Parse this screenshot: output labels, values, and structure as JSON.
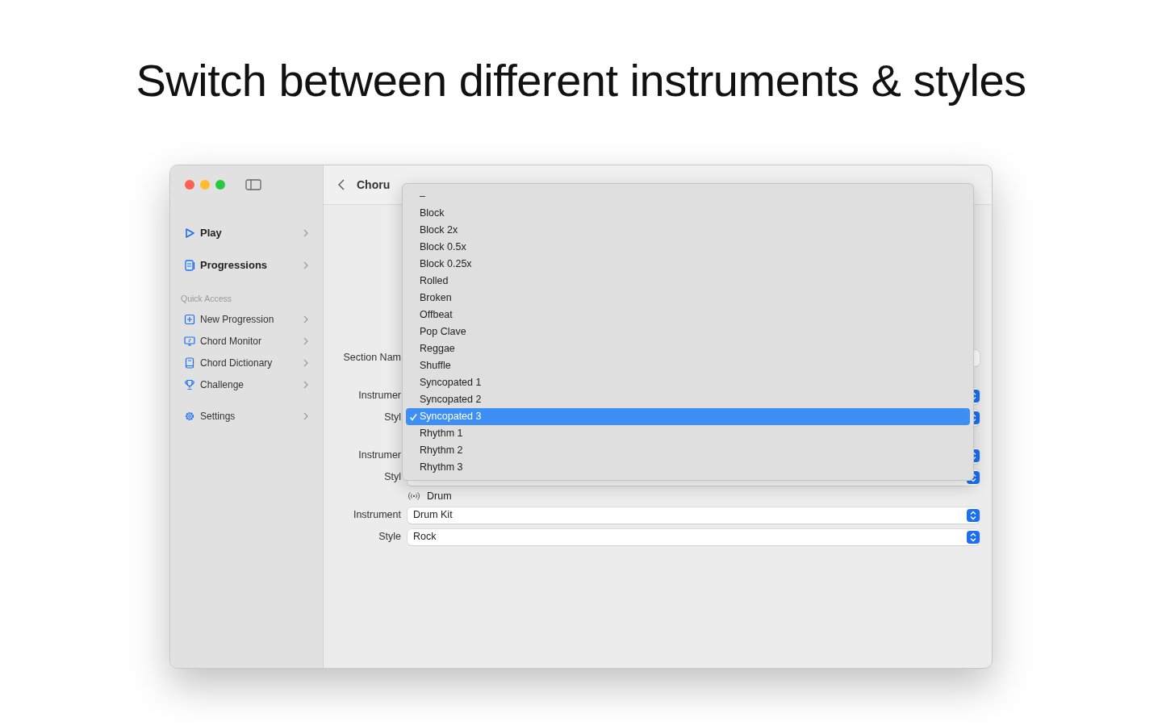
{
  "heading": "Switch between different instruments & styles",
  "sidebar": {
    "main": [
      {
        "label": "Play"
      },
      {
        "label": "Progressions"
      }
    ],
    "quick_access": {
      "title": "Quick Access",
      "items": [
        {
          "label": "New Progression"
        },
        {
          "label": "Chord Monitor"
        },
        {
          "label": "Chord Dictionary"
        },
        {
          "label": "Challenge"
        }
      ]
    },
    "footer": [
      {
        "label": "Settings"
      }
    ]
  },
  "toolbar": {
    "title": "Choru"
  },
  "form": {
    "section_name": {
      "label": "Section Nam"
    },
    "groups": [
      {
        "rows": [
          {
            "label": "Instrumer"
          },
          {
            "label": "Styl"
          }
        ]
      },
      {
        "rows": [
          {
            "label": "Instrumer"
          },
          {
            "label": "Styl"
          }
        ]
      },
      {
        "header": "Drum",
        "rows": [
          {
            "label": "Instrument",
            "value": "Drum Kit"
          },
          {
            "label": "Style",
            "value": "Rock"
          }
        ]
      }
    ]
  },
  "popup": {
    "items": [
      {
        "label": "–",
        "selected": false
      },
      {
        "label": "Block",
        "selected": false
      },
      {
        "label": "Block 2x",
        "selected": false
      },
      {
        "label": "Block 0.5x",
        "selected": false
      },
      {
        "label": "Block 0.25x",
        "selected": false
      },
      {
        "label": "Rolled",
        "selected": false
      },
      {
        "label": "Broken",
        "selected": false
      },
      {
        "label": "Offbeat",
        "selected": false
      },
      {
        "label": "Pop Clave",
        "selected": false
      },
      {
        "label": "Reggae",
        "selected": false
      },
      {
        "label": "Shuffle",
        "selected": false
      },
      {
        "label": "Syncopated 1",
        "selected": false
      },
      {
        "label": "Syncopated 2",
        "selected": false
      },
      {
        "label": "Syncopated 3",
        "selected": true
      },
      {
        "label": "Rhythm 1",
        "selected": false
      },
      {
        "label": "Rhythm 2",
        "selected": false
      },
      {
        "label": "Rhythm 3",
        "selected": false
      }
    ]
  }
}
